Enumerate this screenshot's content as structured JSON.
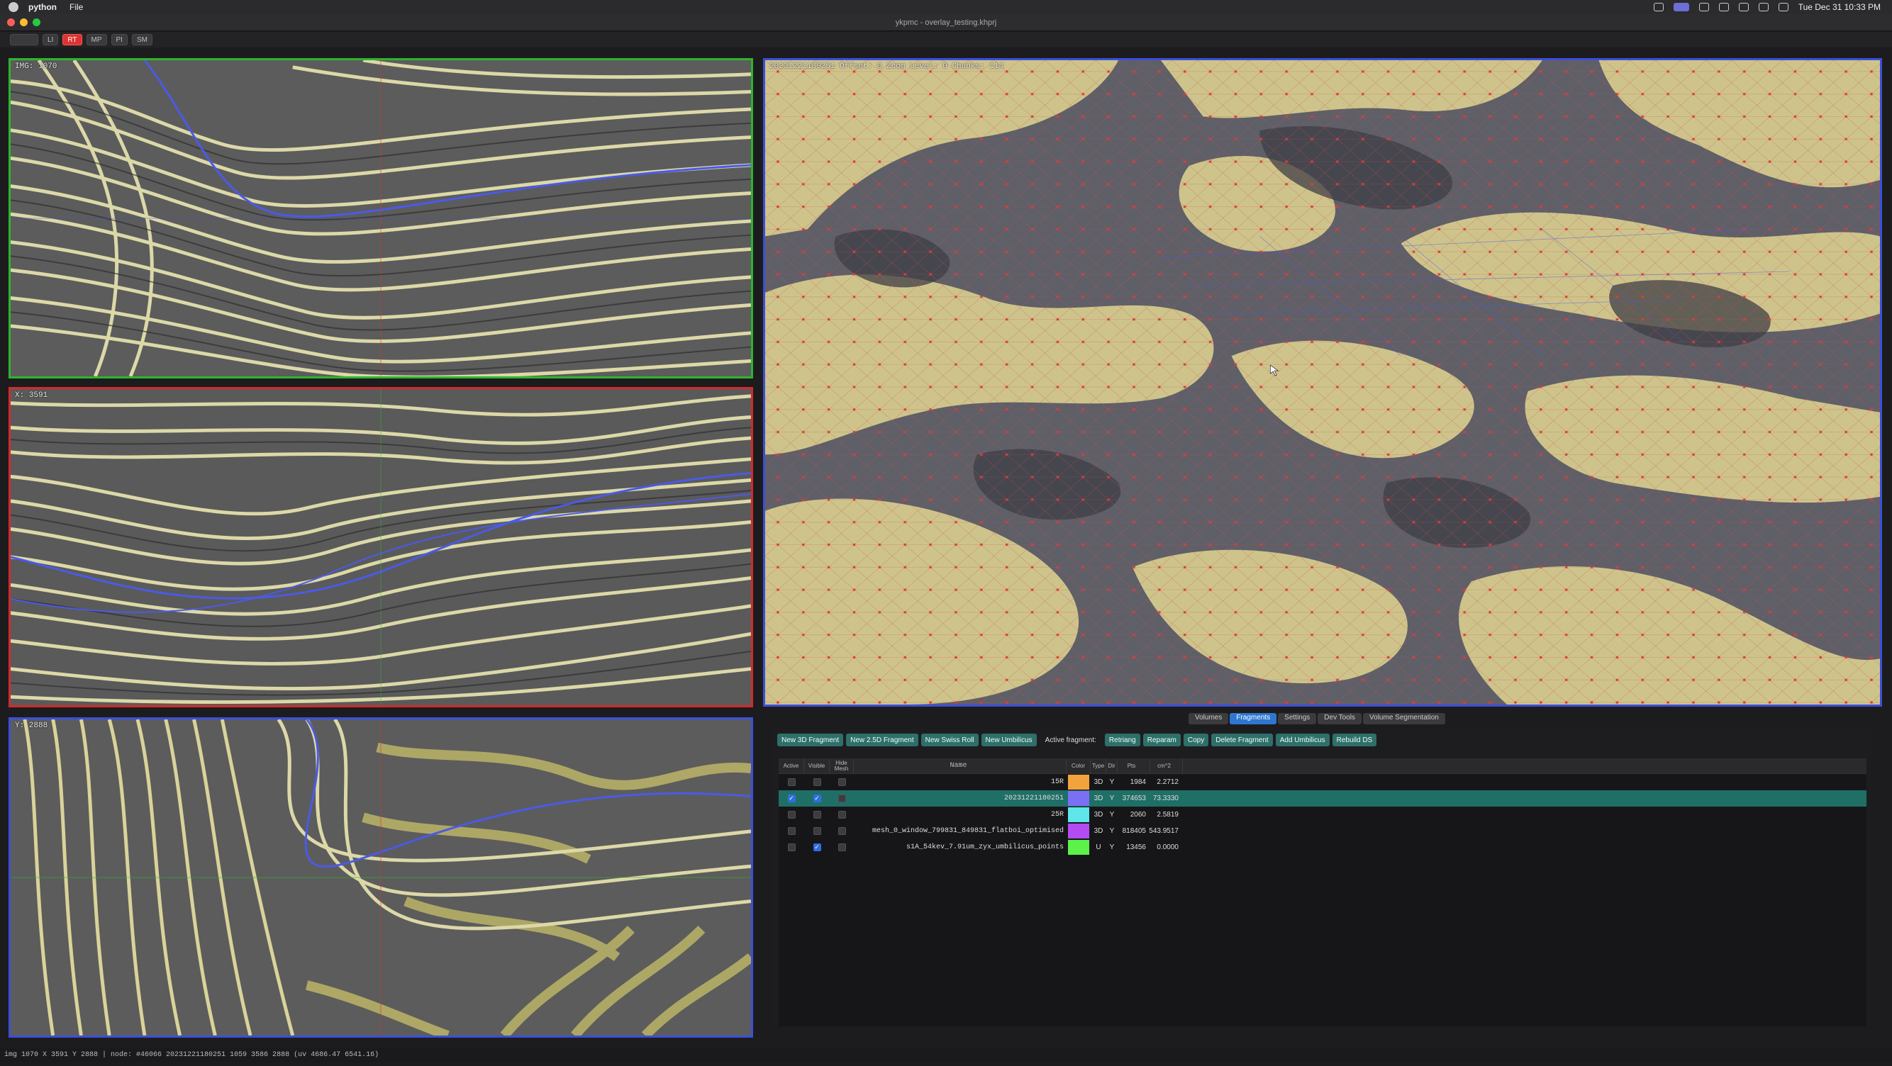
{
  "menubar": {
    "app_name": "python",
    "menu_file": "File",
    "clock": "Tue Dec 31 10:33 PM"
  },
  "window": {
    "title": "ykpmc - overlay_testing.khprj"
  },
  "toolbar": {
    "buttons": [
      "LI",
      "RT",
      "MP",
      "PI",
      "SM"
    ]
  },
  "views": {
    "top_label": "IMG: 1070",
    "mid_label": "X: 3591",
    "bot_label": "Y: 2888",
    "main_label": "20231221180251  Offset: 0  Zoom Level: 0  Chunks: 114"
  },
  "tabs": [
    {
      "label": "Volumes",
      "active": false
    },
    {
      "label": "Fragments",
      "active": true
    },
    {
      "label": "Settings",
      "active": false
    },
    {
      "label": "Dev Tools",
      "active": false
    },
    {
      "label": "Volume Segmentation",
      "active": false
    }
  ],
  "actions": {
    "new_3d": "New 3D Fragment",
    "new_25d": "New 2.5D Fragment",
    "new_swiss": "New Swiss Roll",
    "new_umbilicus": "New Umbilicus",
    "active_fragment": "Active fragment:",
    "retriang": "Retriang",
    "reparam": "Reparam",
    "copy": "Copy",
    "delete": "Delete Fragment",
    "add_umbilicus": "Add Umbilicus",
    "rebuild": "Rebuild DS"
  },
  "table": {
    "headers": {
      "active": "Active",
      "visible": "Visible",
      "hide_mesh": "Hide Mesh",
      "name": "Name",
      "color": "Color",
      "type": "Type",
      "dir": "Dir",
      "pts": "Pts",
      "cm2": "cm^2"
    },
    "rows": [
      {
        "name": "15R",
        "color": "#f2a33c",
        "type": "3D",
        "dir": "Y",
        "pts": "1984",
        "cm2": "2.2712",
        "active": false,
        "visible": false,
        "selected": false
      },
      {
        "name": "20231221180251",
        "color": "#7b6ff5",
        "type": "3D",
        "dir": "Y",
        "pts": "374653",
        "cm2": "73.3330",
        "active": true,
        "visible": true,
        "selected": true
      },
      {
        "name": "25R",
        "color": "#5ee6e8",
        "type": "3D",
        "dir": "Y",
        "pts": "2060",
        "cm2": "2.5819",
        "active": false,
        "visible": false,
        "selected": false
      },
      {
        "name": "mesh_0_window_799831_849831_flatboi_optimised",
        "color": "#b34cf2",
        "type": "3D",
        "dir": "Y",
        "pts": "818405",
        "cm2": "543.9517",
        "active": false,
        "visible": false,
        "selected": false
      },
      {
        "name": "s1A_54kev_7.91um_zyx_umbilicus_points",
        "color": "#5cf24a",
        "type": "U",
        "dir": "Y",
        "pts": "13456",
        "cm2": "0.0000",
        "active": false,
        "visible": true,
        "selected": false
      }
    ]
  },
  "statusbar": {
    "text": "img 1070  X 3591  Y 2888  |  node: #46066 20231221180251 1059 3586 2888 (uv 4686.47 6541.16)"
  }
}
